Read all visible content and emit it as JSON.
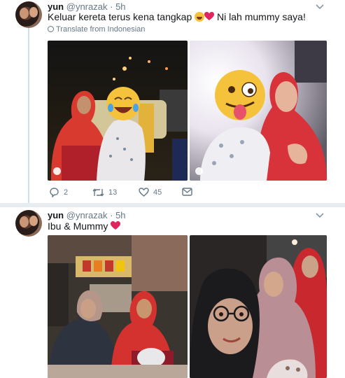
{
  "tweets": [
    {
      "display_name": "yun",
      "handle": "@ynrazak",
      "sep": "·",
      "time": "5h",
      "text_part1": "Keluar kereta terus kena tangkap",
      "text_part2": "Ni lah mummy saya!",
      "translate_label": "Translate from Indonesian",
      "replies": "2",
      "retweets": "13",
      "likes": "45"
    },
    {
      "display_name": "yun",
      "handle": "@ynrazak",
      "sep": "·",
      "time": "5h",
      "text_part1": "Ibu & Mummy"
    }
  ],
  "icons": {
    "reply": "reply-icon",
    "retweet": "retweet-icon",
    "like": "heart-icon",
    "dm": "envelope-icon",
    "more": "chevron-down-icon",
    "translate": "globe-icon",
    "heart_emoji": "red-heart-emoji",
    "laugh_emoji": "laughing-emoji"
  },
  "colors": {
    "heart": "#e0245e",
    "muted": "#657786",
    "thread": "#cbe1ef",
    "separator": "#e6ecf0"
  }
}
